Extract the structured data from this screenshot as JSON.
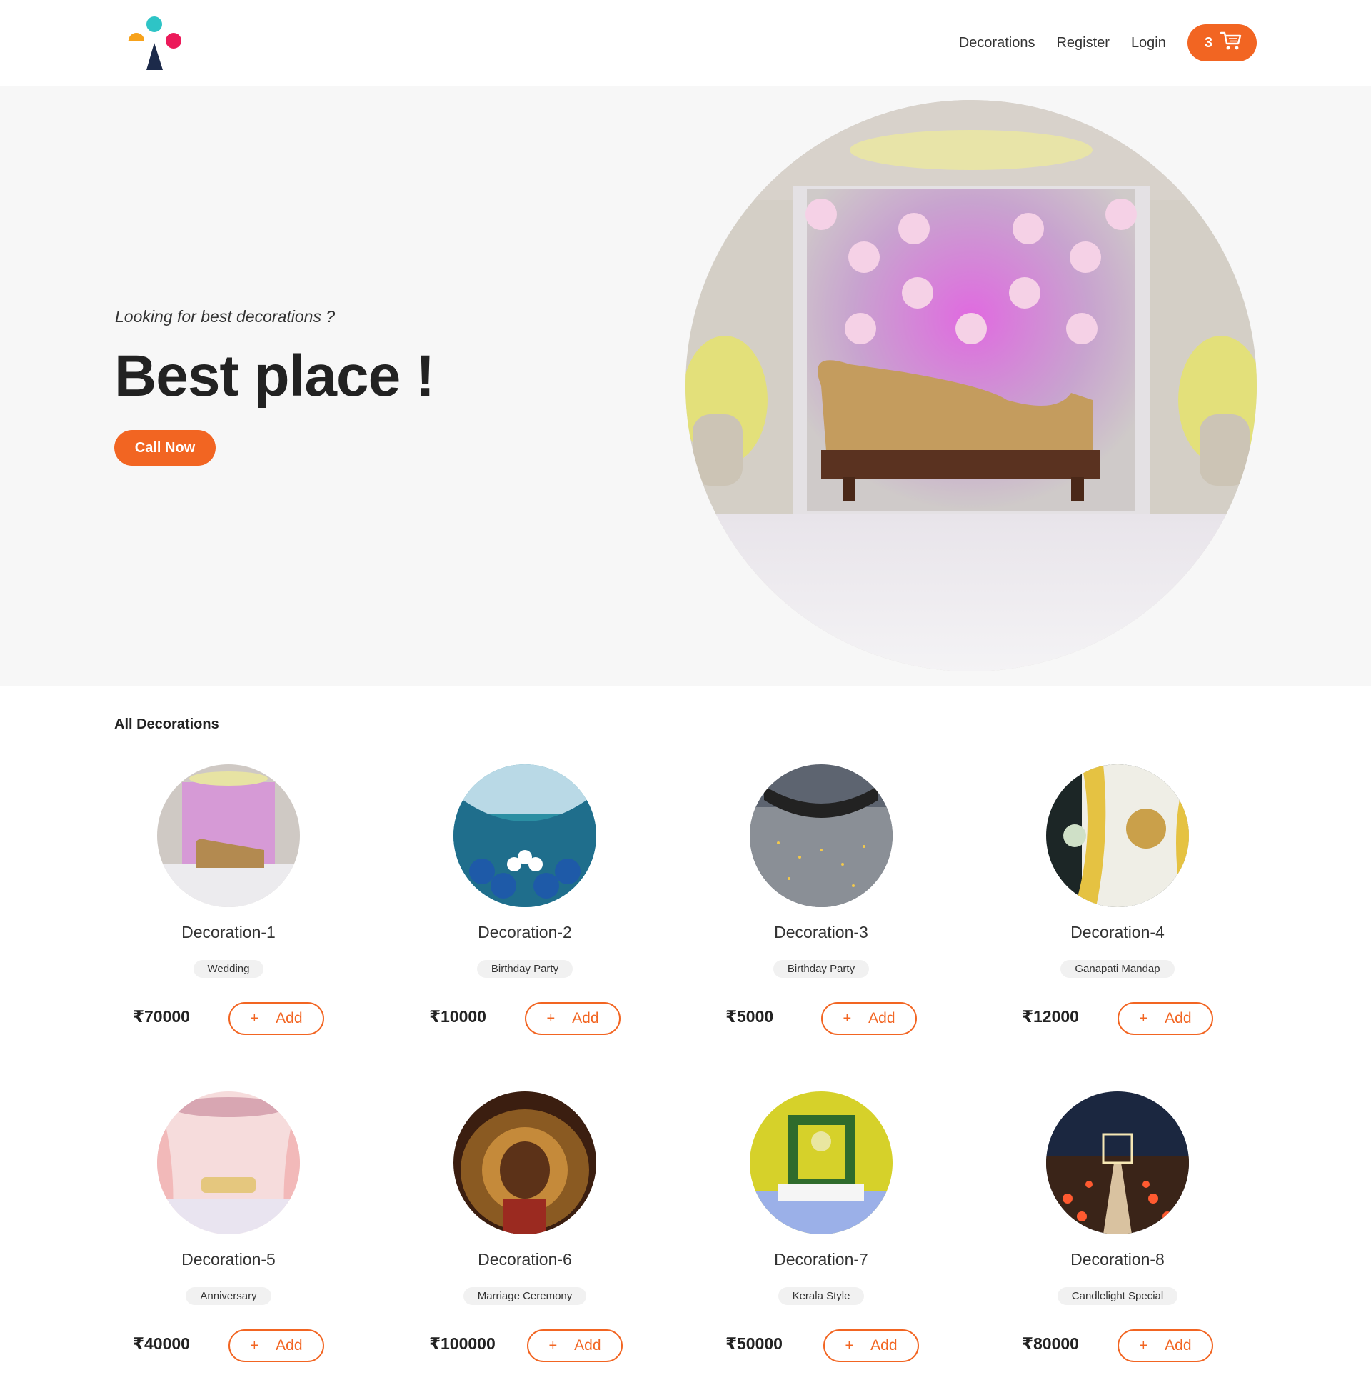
{
  "nav": {
    "links": [
      "Decorations",
      "Register",
      "Login"
    ],
    "cart_count": "3"
  },
  "hero": {
    "tagline": "Looking for best decorations ?",
    "title": "Best place !",
    "cta": "Call Now"
  },
  "section": {
    "title": "All Decorations"
  },
  "add_label": "Add",
  "add_plus": "+",
  "products": [
    {
      "name": "Decoration-1",
      "category": "Wedding",
      "price": "₹70000"
    },
    {
      "name": "Decoration-2",
      "category": "Birthday Party",
      "price": "₹10000"
    },
    {
      "name": "Decoration-3",
      "category": "Birthday Party",
      "price": "₹5000"
    },
    {
      "name": "Decoration-4",
      "category": "Ganapati Mandap",
      "price": "₹12000"
    },
    {
      "name": "Decoration-5",
      "category": "Anniversary",
      "price": "₹40000"
    },
    {
      "name": "Decoration-6",
      "category": "Marriage Ceremony",
      "price": "₹100000"
    },
    {
      "name": "Decoration-7",
      "category": "Kerala Style",
      "price": "₹50000"
    },
    {
      "name": "Decoration-8",
      "category": "Candlelight Special",
      "price": "₹80000"
    }
  ],
  "colors": {
    "accent": "#f26522",
    "hero_bg": "#f7f7f7"
  },
  "icons": {
    "logo": "brand-logo",
    "cart": "cart-icon"
  }
}
